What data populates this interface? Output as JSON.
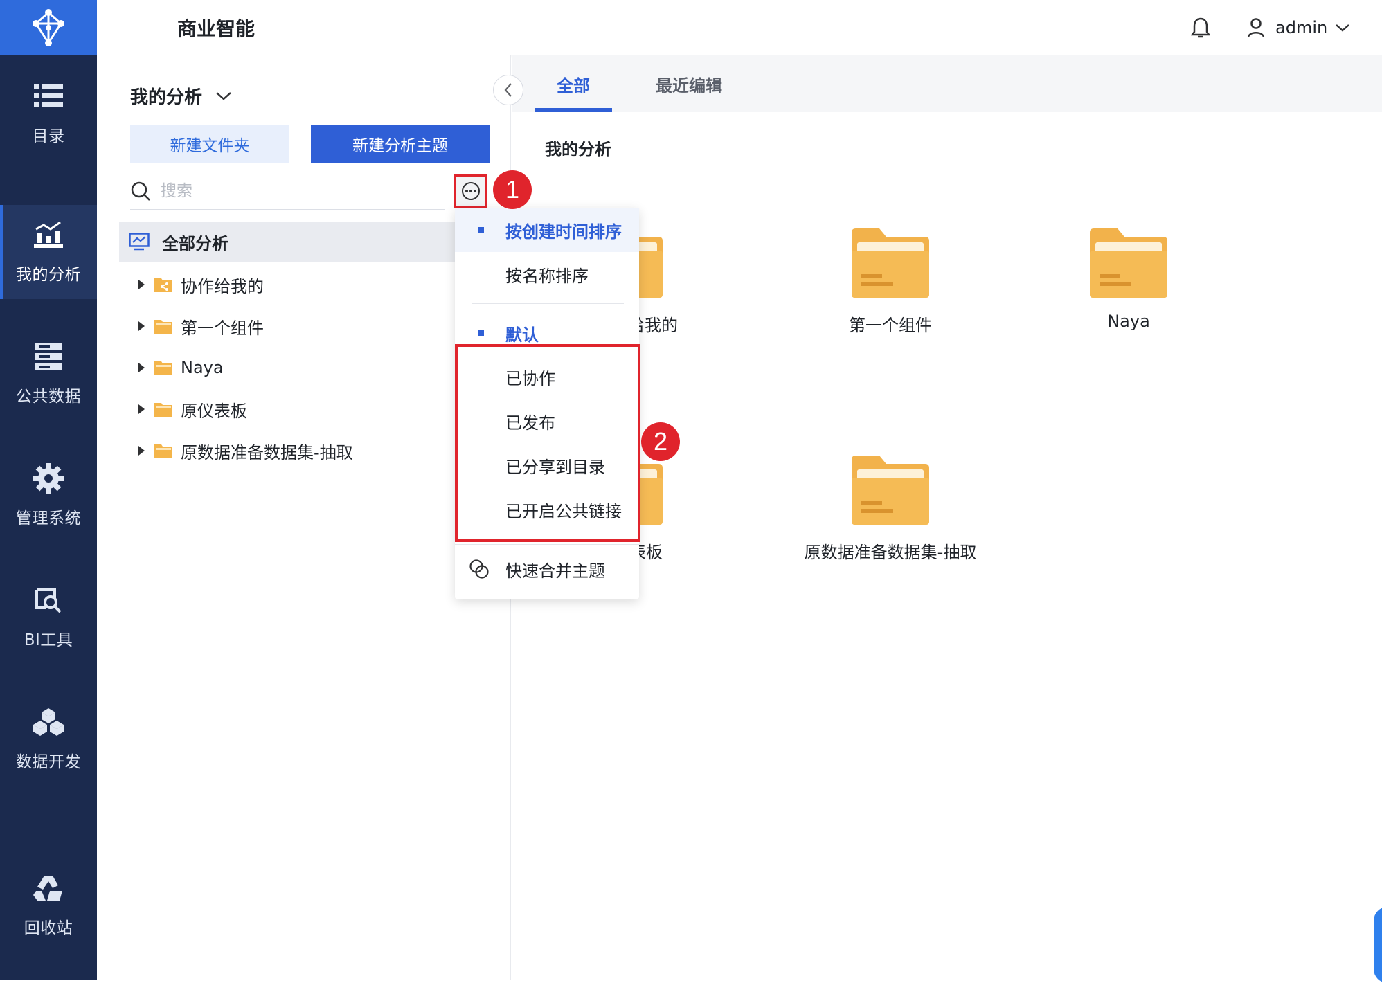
{
  "app": {
    "title": "商业智能"
  },
  "nav": {
    "items": [
      {
        "label": "目录",
        "icon": "list-icon"
      },
      {
        "label": "我的分析",
        "icon": "analysis-chart-icon",
        "active": true
      },
      {
        "label": "公共数据",
        "icon": "database-icon"
      },
      {
        "label": "管理系统",
        "icon": "gear-icon"
      },
      {
        "label": "BI工具",
        "icon": "bi-tool-icon"
      },
      {
        "label": "数据开发",
        "icon": "cube-cluster-icon"
      },
      {
        "label": "回收站",
        "icon": "recycle-icon"
      }
    ]
  },
  "header": {
    "username": "admin"
  },
  "panel": {
    "title": "我的分析",
    "new_folder": "新建文件夹",
    "new_theme": "新建分析主题",
    "search_placeholder": "搜索",
    "tree_root": "全部分析",
    "tree_items": [
      "协作给我的",
      "第一个组件",
      "Naya",
      "原仪表板",
      "原数据准备数据集-抽取"
    ]
  },
  "content": {
    "tabs": [
      "全部",
      "最近编辑"
    ],
    "active_tab": "全部",
    "section_title": "我的分析",
    "cards": [
      {
        "label": "协作给我的",
        "visible_label": "作给我的",
        "type": "shared-folder"
      },
      {
        "label": "第一个组件",
        "type": "folder"
      },
      {
        "label": "Naya",
        "type": "folder"
      },
      {
        "label": "原仪表板",
        "visible_label": "仪表板",
        "type": "folder"
      },
      {
        "label": "原数据准备数据集-抽取",
        "type": "folder"
      }
    ]
  },
  "menu": {
    "sort_options": [
      "按创建时间排序",
      "按名称排序"
    ],
    "selected_sort": "按创建时间排序",
    "filter_group": "默认",
    "filter_options": [
      "已协作",
      "已发布",
      "已分享到目录",
      "已开启公共链接"
    ],
    "merge": "快速合并主题"
  },
  "annotations": {
    "badge1": "1",
    "badge2": "2",
    "highlight_color": "#e0242c"
  },
  "colors": {
    "nav_bg": "#1b2a4e",
    "accent": "#2f5fd6",
    "folder": "#f4b54a"
  }
}
